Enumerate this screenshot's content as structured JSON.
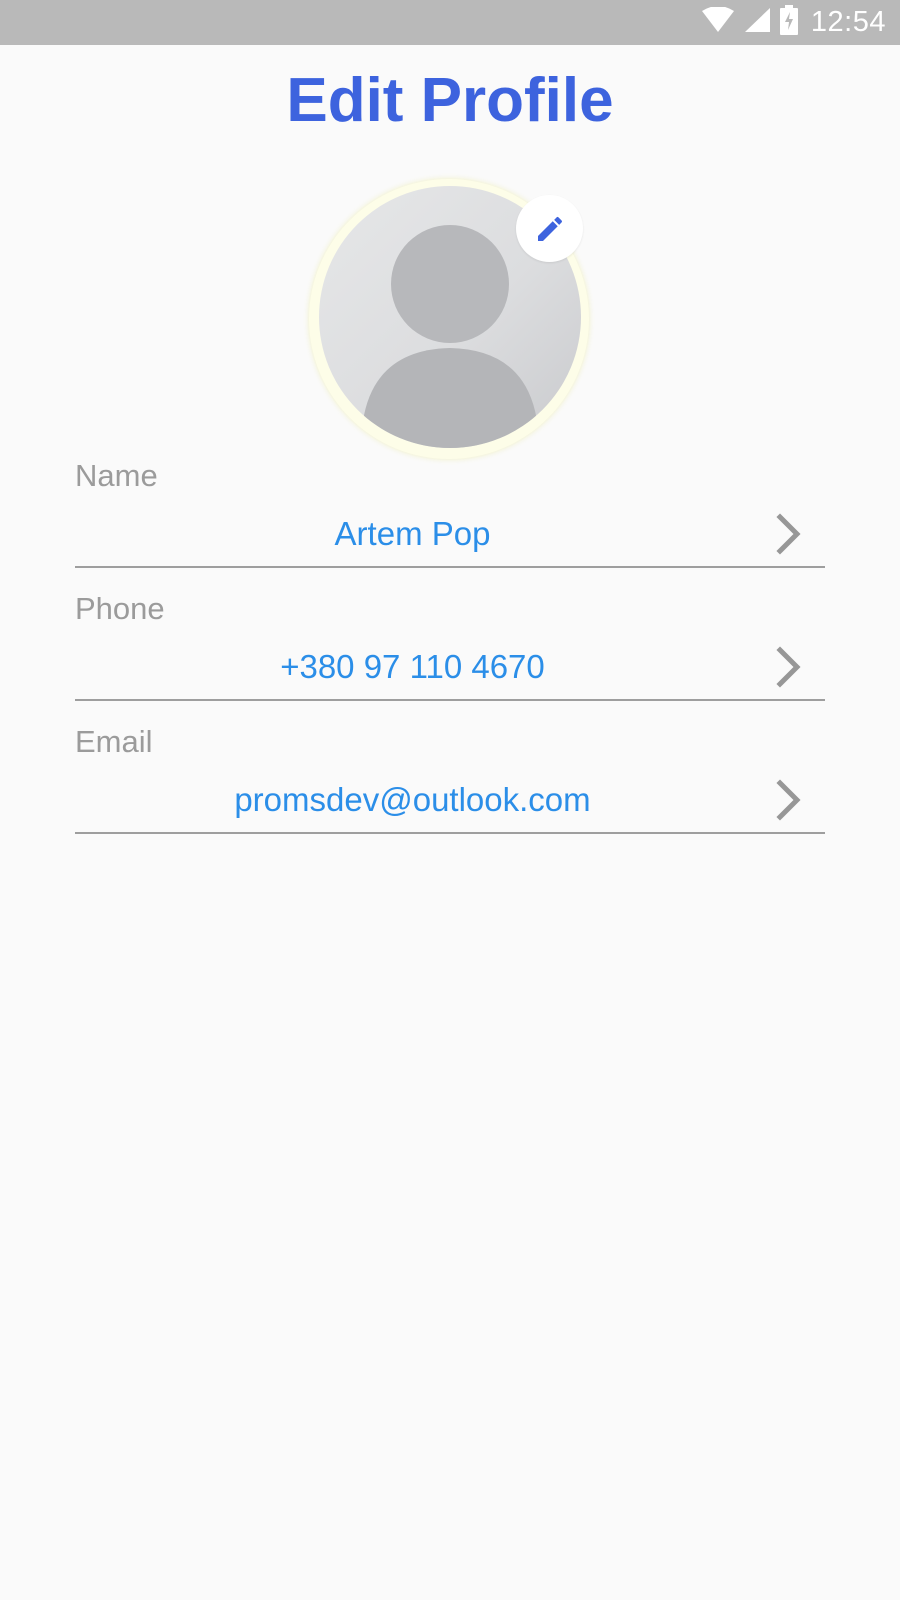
{
  "status_bar": {
    "time": "12:54",
    "icons": [
      "wifi-icon",
      "signal-icon",
      "battery-charging-icon"
    ]
  },
  "page": {
    "title": "Edit Profile"
  },
  "avatar": {
    "icon": "person-placeholder-icon",
    "edit_icon": "pencil-icon"
  },
  "fields": [
    {
      "label": "Name",
      "value": "Artem Pop",
      "icon": "chevron-right-icon"
    },
    {
      "label": "Phone",
      "value": "+380 97 110 4670",
      "icon": "chevron-right-icon"
    },
    {
      "label": "Email",
      "value": "promsdev@outlook.com",
      "icon": "chevron-right-icon"
    }
  ],
  "colors": {
    "title": "#3d63de",
    "value": "#2b8ee8",
    "label": "#9b9b9b",
    "status_bar": "#b9b9b9",
    "background": "#fafafa"
  }
}
